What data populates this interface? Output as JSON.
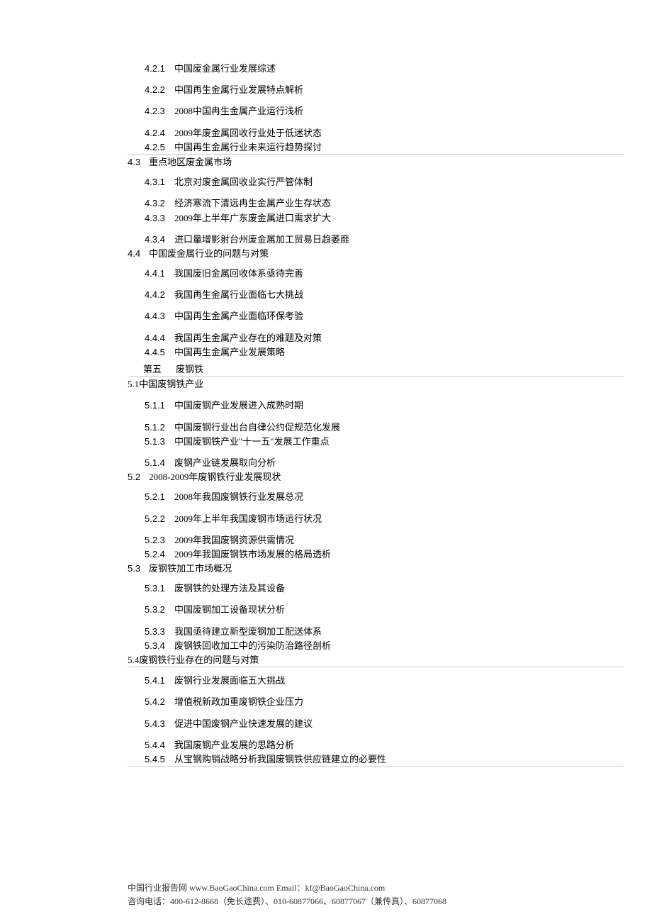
{
  "toc": {
    "s421": {
      "num": "4.2.1",
      "text": "中国废金属行业发展综述"
    },
    "s422": {
      "num": "4.2.2",
      "text": "中国再生金属行业发展特点解析"
    },
    "s423": {
      "num": "4.2.3",
      "text": "2008中国冉生金属产业运行浅析"
    },
    "s424": {
      "num": "4.2.4",
      "text": "2009年废金属回收行业处于低迷状态"
    },
    "s425": {
      "num": "4.2.5",
      "text": "中国再生金属行业未来运行趋势探讨"
    },
    "sec43": {
      "num": "4.3",
      "text": "重点地区废金属市场"
    },
    "s431": {
      "num": "4.3.1",
      "text": "北京对废金属回收业实行严管体制"
    },
    "s432": {
      "num": "4.3.2",
      "text": "经济寒流下清远冉生金属产业生存状态"
    },
    "s433": {
      "num": "4.3.3",
      "text": "2009年上半年广东废金属进口需求扩大"
    },
    "s434": {
      "num": "4.3.4",
      "text": "进口量增影射台州废金属加工贸易日趋萎靡"
    },
    "sec44": {
      "num": "4.4",
      "text": "中国废金属行业的问题与对策"
    },
    "s441": {
      "num": "4.4.1",
      "text": "我国废旧金属回收体系亟待完善"
    },
    "s442": {
      "num": "4.4.2",
      "text": "我国再生金属行业面临七大挑战"
    },
    "s443": {
      "num": "4.4.3",
      "text": "中国再生金属产业面临环保考验"
    },
    "s444": {
      "num": "4.4.4",
      "text": "我国再生金属产业存在的难题及对策"
    },
    "s445": {
      "num": "4.4.5",
      "text": "中国再生金属产业发展策略"
    },
    "ch5": {
      "label": "第五",
      "title": "废钢铁"
    },
    "sec51": {
      "text": "5.1中国废钢铁产业"
    },
    "s511": {
      "num": "5.1.1",
      "text": "中国废钢产业发展进入成熟时期"
    },
    "s512": {
      "num": "5.1.2",
      "text": "中国废钢行业出台自律公约促规范化发展"
    },
    "s513": {
      "num": "5.1.3",
      "text": "中国废钢铁产业\"十一五\"发展工作重点"
    },
    "s514": {
      "num": "5.1.4",
      "text": "废钢产业链发展取向分析"
    },
    "sec52": {
      "num": "5.2",
      "text": "2008-2009年废钢铁行业发展现状"
    },
    "s521": {
      "num": "5.2.1",
      "text": "2008年我国废钢铁行业发展总况"
    },
    "s522": {
      "num": "5.2.2",
      "text": "2009年上半年我国废钢市场运行状况"
    },
    "s523": {
      "num": "5.2.3",
      "text": "2009年我国废钢资源供需情况"
    },
    "s524": {
      "num": "5.2.4",
      "text": "2009年我国废钢铁市场发展的格局透析"
    },
    "sec53": {
      "num": "5.3",
      "text": "废钢铁加工市场概况"
    },
    "s531": {
      "num": "5.3.1",
      "text": "废钢铁的处理方法及其设备"
    },
    "s532": {
      "num": "5.3.2",
      "text": "中国废钢加工设备现状分析"
    },
    "s533": {
      "num": "5.3.3",
      "text": "我国亟待建立新型废钢加工配送体系"
    },
    "s534": {
      "num": "5.3.4",
      "text": "废钢铁回收加工中的污染防治路径剖析"
    },
    "sec54": {
      "text": "5.4废钢铁行业存在的问题与对策"
    },
    "s541": {
      "num": "5.4.1",
      "text": "废钢行业发展面临五大挑战"
    },
    "s542": {
      "num": "5.4.2",
      "text": "增值税新政加重废钢铁企业压力"
    },
    "s543": {
      "num": "5.4.3",
      "text": "促进中国废钢产业快速发展的建议"
    },
    "s544": {
      "num": "5.4.4",
      "text": "我国废钢产业发展的思路分析"
    },
    "s545": {
      "num": "5.4.5",
      "text": "从宝钢购销战略分析我国废钢铁供应链建立的必要性"
    }
  },
  "footer": {
    "line1": "中国行业报告网 www.BaoGaoChina.com Email：kf@BaoGaoChina.com",
    "line2": "咨询电话：400-612-8668（免长途费）、010-60877066、60877067（兼传真）、60877068"
  }
}
